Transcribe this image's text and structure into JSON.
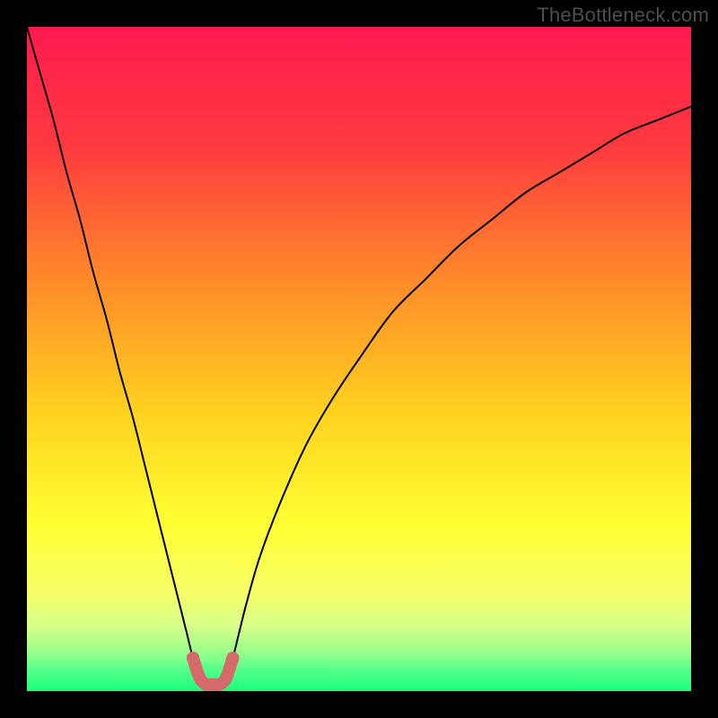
{
  "watermark": "TheBottleneck.com",
  "chart_data": {
    "type": "line",
    "title": "",
    "xlabel": "",
    "ylabel": "",
    "xlim": [
      0,
      100
    ],
    "ylim": [
      0,
      100
    ],
    "grid": false,
    "legend": false,
    "background_gradient_stops": [
      {
        "offset": 0.0,
        "color": "#ff1a4f"
      },
      {
        "offset": 0.18,
        "color": "#ff3a3f"
      },
      {
        "offset": 0.38,
        "color": "#ff8a2a"
      },
      {
        "offset": 0.58,
        "color": "#ffd21f"
      },
      {
        "offset": 0.75,
        "color": "#ffff33"
      },
      {
        "offset": 0.85,
        "color": "#f7ff66"
      },
      {
        "offset": 0.9,
        "color": "#d9ff8a"
      },
      {
        "offset": 0.94,
        "color": "#9cff8a"
      },
      {
        "offset": 0.97,
        "color": "#4fff8a"
      },
      {
        "offset": 1.0,
        "color": "#1aff7a"
      }
    ],
    "series": [
      {
        "name": "bottleneck-curve",
        "stroke": "#000000",
        "stroke_width": 2,
        "x": [
          0,
          2,
          4,
          6,
          8,
          10,
          12,
          14,
          16,
          18,
          20,
          22,
          24,
          25,
          26,
          27,
          28,
          29,
          30,
          31,
          32,
          33,
          35,
          38,
          42,
          46,
          50,
          55,
          60,
          65,
          70,
          75,
          80,
          85,
          90,
          95,
          100
        ],
        "y": [
          100,
          93,
          86,
          78,
          71,
          63,
          56,
          48,
          41,
          33,
          25,
          17,
          9,
          5,
          2,
          1,
          1,
          1,
          2,
          5,
          9,
          13,
          20,
          28,
          37,
          44,
          50,
          57,
          62,
          67,
          71,
          75,
          78,
          81,
          84,
          86,
          88
        ]
      }
    ],
    "highlight": {
      "name": "optimal-zone",
      "color": "#d46a6a",
      "stroke_width": 14,
      "x": [
        25,
        26,
        27,
        28,
        29,
        30,
        31
      ],
      "y": [
        5,
        2,
        1,
        1,
        1,
        2,
        5
      ]
    }
  }
}
